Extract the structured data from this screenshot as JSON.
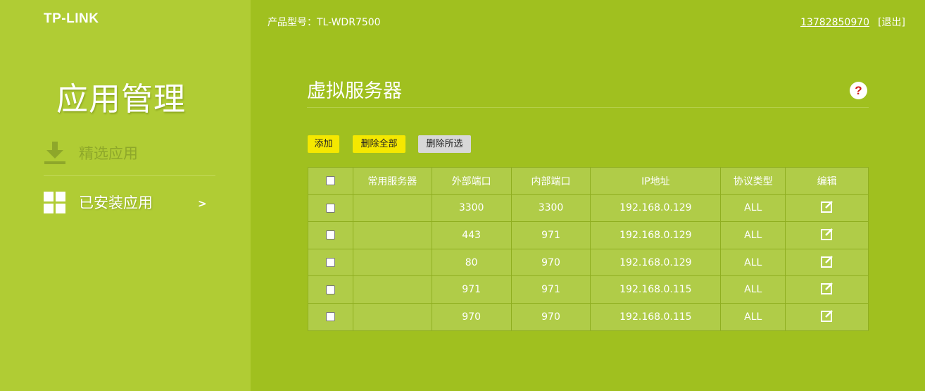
{
  "header": {
    "logo": "TP-LINK",
    "model": "产品型号：TL-WDR7500",
    "account": "13782850970",
    "logout": "[退出]"
  },
  "sidebar": {
    "title": "应用管理",
    "items": [
      {
        "label": "精选应用",
        "icon": "download-icon"
      },
      {
        "label": "已安装应用",
        "icon": "grid-icon",
        "arrow": ">"
      }
    ]
  },
  "main": {
    "title": "虚拟服务器",
    "help": "?",
    "buttons": {
      "add": "添加",
      "delete_all": "删除全部",
      "delete_selected": "删除所选"
    },
    "table": {
      "headers": [
        "常用服务器",
        "外部端口",
        "内部端口",
        "IP地址",
        "协议类型",
        "编辑"
      ],
      "rows": [
        {
          "service": "",
          "ext_port": "3300",
          "int_port": "3300",
          "ip": "192.168.0.129",
          "protocol": "ALL"
        },
        {
          "service": "",
          "ext_port": "443",
          "int_port": "971",
          "ip": "192.168.0.129",
          "protocol": "ALL"
        },
        {
          "service": "",
          "ext_port": "80",
          "int_port": "970",
          "ip": "192.168.0.129",
          "protocol": "ALL"
        },
        {
          "service": "",
          "ext_port": "971",
          "int_port": "971",
          "ip": "192.168.0.115",
          "protocol": "ALL"
        },
        {
          "service": "",
          "ext_port": "970",
          "int_port": "970",
          "ip": "192.168.0.115",
          "protocol": "ALL"
        }
      ]
    }
  },
  "colors": {
    "main_bg": "#a0c01f",
    "sidebar_bg": "#b0cc34",
    "accent_button": "#f5e800"
  }
}
